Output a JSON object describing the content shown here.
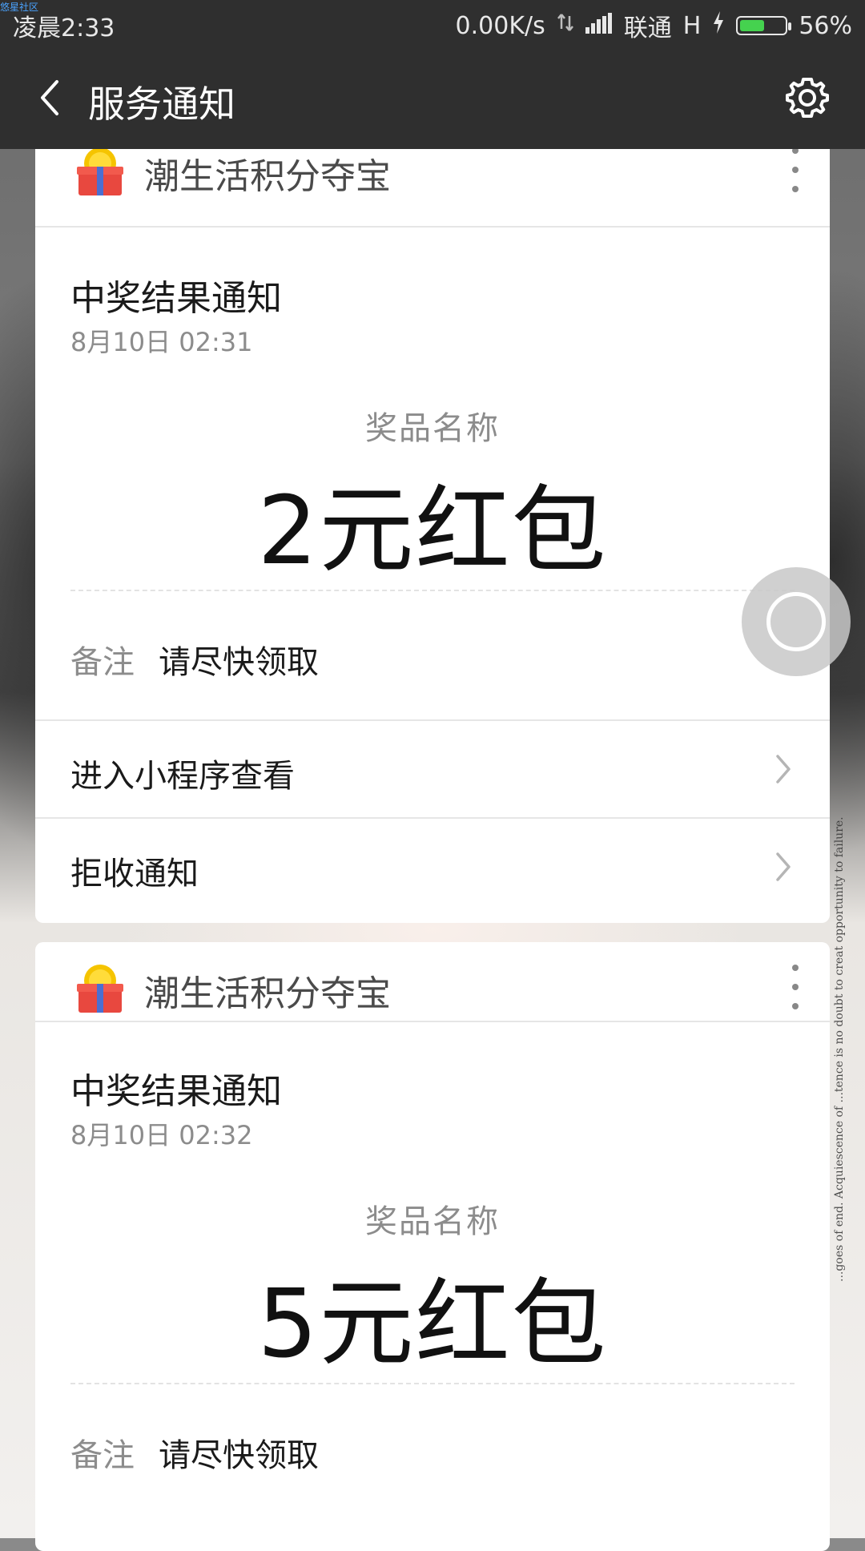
{
  "status_bar": {
    "watermark": "悠星社区",
    "time": "凌晨2:33",
    "net_speed": "0.00K/s",
    "carrier": "联通",
    "network_type": "H",
    "battery_percent": "56%",
    "battery_level": 0.56,
    "accent_green": "#45d24f"
  },
  "app_bar": {
    "title": "服务通知",
    "back_icon": "chevron-left-icon",
    "settings_icon": "gear-icon"
  },
  "cards": [
    {
      "app_name": "潮生活积分夺宝",
      "title": "中奖结果通知",
      "time": "8月10日  02:31",
      "prize_label": "奖品名称",
      "prize_value": "2元红包",
      "note_label": "备注",
      "note_value": "请尽快领取",
      "action_open": "进入小程序查看",
      "action_reject": "拒收通知"
    },
    {
      "app_name": "潮生活积分夺宝",
      "title": "中奖结果通知",
      "time": "8月10日  02:32",
      "prize_label": "奖品名称",
      "prize_value": "5元红包",
      "note_label": "备注",
      "note_value": "请尽快领取"
    }
  ],
  "side_text": "...goes of end. Acquiescence of ...tence is no doubt to creat opportunity to failure."
}
